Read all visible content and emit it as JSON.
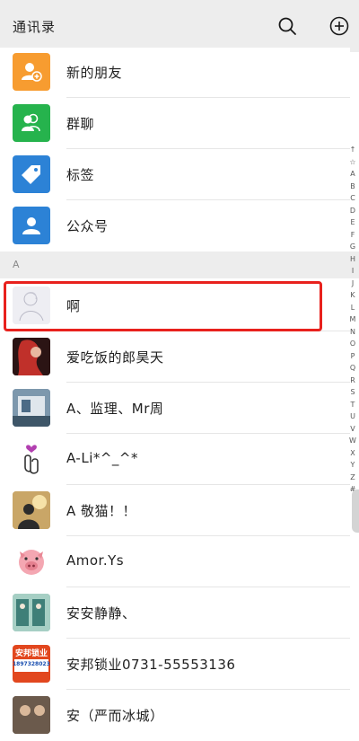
{
  "header": {
    "title": "通讯录"
  },
  "fixed_items": [
    {
      "label": "新的朋友",
      "icon": "add-friend-icon",
      "color": "#f79c30"
    },
    {
      "label": "群聊",
      "icon": "group-chat-icon",
      "color": "#26b34d"
    },
    {
      "label": "标签",
      "icon": "tag-icon",
      "color": "#2c82d6"
    },
    {
      "label": "公众号",
      "icon": "official-account-icon",
      "color": "#2c82d6"
    }
  ],
  "section": {
    "letter": "A"
  },
  "contacts": [
    {
      "name": "啊"
    },
    {
      "name": "爱吃饭的郎昊天"
    },
    {
      "name": "A、监理、Mr周"
    },
    {
      "name": "A-Li*^_^*"
    },
    {
      "name": "A      敬猫！！"
    },
    {
      "name": "Amor.Ys"
    },
    {
      "name": "安安静静、"
    },
    {
      "name": "安邦锁业0731-55553136",
      "avatar_text_1": "安邦锁业",
      "avatar_text_2": "18973280232"
    },
    {
      "name": "安（严而冰城）"
    }
  ],
  "alphabet": [
    "↑",
    "☆",
    "A",
    "B",
    "C",
    "D",
    "E",
    "F",
    "G",
    "H",
    "I",
    "J",
    "K",
    "L",
    "M",
    "N",
    "O",
    "P",
    "Q",
    "R",
    "S",
    "T",
    "U",
    "V",
    "W",
    "X",
    "Y",
    "Z",
    "#"
  ]
}
